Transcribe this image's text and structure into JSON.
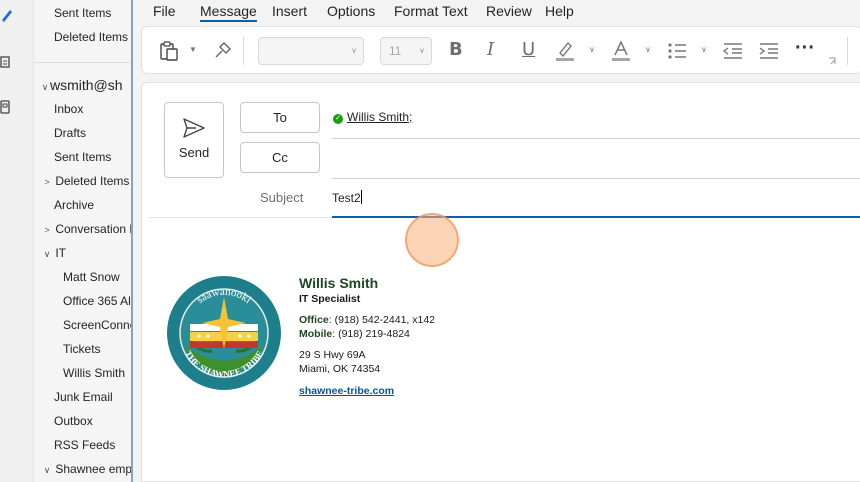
{
  "folders": {
    "top_items": [
      {
        "label": "Sent Items",
        "chevron": ""
      },
      {
        "label": "Deleted Items",
        "chevron": ""
      }
    ],
    "account": {
      "label": "wsmith@sh",
      "chevron": "v"
    },
    "items": [
      {
        "label": "Inbox",
        "chevron": "",
        "indent": 0
      },
      {
        "label": "Drafts",
        "chevron": "",
        "indent": 0
      },
      {
        "label": "Sent Items",
        "chevron": "",
        "indent": 0
      },
      {
        "label": "Deleted Items",
        "chevron": ">",
        "indent": 0
      },
      {
        "label": "Archive",
        "chevron": "",
        "indent": 0
      },
      {
        "label": "Conversation H",
        "chevron": ">",
        "indent": 0
      },
      {
        "label": "IT",
        "chevron": "v",
        "indent": 0
      },
      {
        "label": "Matt Snow",
        "chevron": "",
        "indent": 1
      },
      {
        "label": "Office 365 Al",
        "chevron": "",
        "indent": 1
      },
      {
        "label": "ScreenConne",
        "chevron": "",
        "indent": 1
      },
      {
        "label": "Tickets",
        "chevron": "",
        "indent": 1
      },
      {
        "label": "Willis Smith",
        "chevron": "",
        "indent": 1
      },
      {
        "label": "Junk Email",
        "chevron": "",
        "indent": 0
      },
      {
        "label": "Outbox",
        "chevron": "",
        "indent": 0
      },
      {
        "label": "RSS Feeds",
        "chevron": "",
        "indent": 0
      },
      {
        "label": "Shawnee empl",
        "chevron": "v",
        "indent": 0
      }
    ]
  },
  "menu": {
    "file": "File",
    "message": "Message",
    "insert": "Insert",
    "options": "Options",
    "format_text": "Format Text",
    "review": "Review",
    "help": "Help",
    "active": "Message"
  },
  "ribbon": {
    "font_name": "",
    "font_size": "11",
    "bold": "B",
    "italic": "I",
    "underline": "U",
    "more": "···",
    "icons": [
      "paste-icon",
      "format-painter-icon",
      "highlight-icon",
      "font-color-icon",
      "bullets-icon",
      "decrease-indent-icon",
      "increase-indent-icon",
      "more-icon"
    ]
  },
  "compose": {
    "send_label": "Send",
    "to_label": "To",
    "cc_label": "Cc",
    "to_recipient": "Willis Smith;",
    "cc_value": "",
    "subject_label": "Subject",
    "subject_value": "Test2",
    "colors": {
      "accent": "#115ea3",
      "resolved": "#13a10e"
    }
  },
  "signature": {
    "name": "Willis Smith",
    "title": "IT Specialist",
    "office_label": "Office",
    "office_value": "(918) 542-2441, x142",
    "mobile_label": "Mobile",
    "mobile_value": "(918) 219-4824",
    "address_line1": "29 S Hwy 69A",
    "address_line2": "Miami, OK  74354",
    "website": "shawnee-tribe.com",
    "logo_text_top": "saawanooki",
    "logo_text_bottom": "THE SHAWNEE TRIBE"
  }
}
